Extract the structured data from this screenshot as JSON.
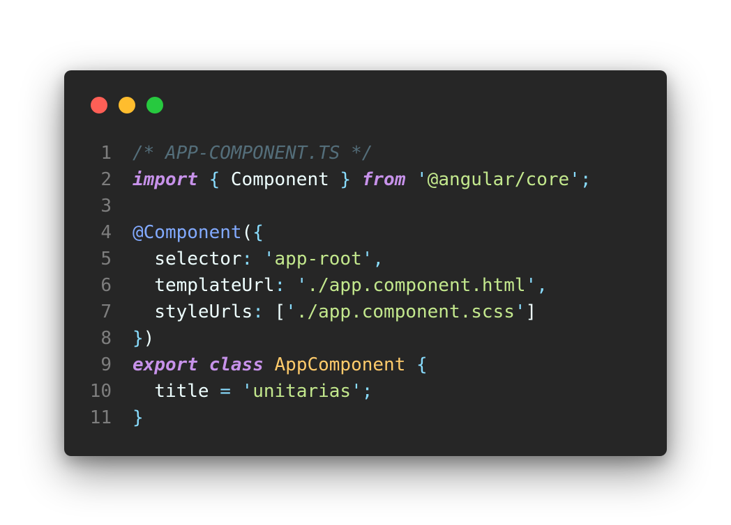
{
  "window": {
    "controls": {
      "close_color": "#ff5f56",
      "minimize_color": "#ffbd2e",
      "maximize_color": "#27c93f"
    }
  },
  "code": {
    "language": "typescript",
    "lines": [
      {
        "number": "1",
        "tokens": [
          {
            "type": "comment",
            "text": "/* APP-COMPONENT.TS */"
          }
        ]
      },
      {
        "number": "2",
        "tokens": [
          {
            "type": "keyword",
            "text": "import"
          },
          {
            "type": "plain",
            "text": " "
          },
          {
            "type": "punctuation",
            "text": "{"
          },
          {
            "type": "plain",
            "text": " Component "
          },
          {
            "type": "punctuation",
            "text": "}"
          },
          {
            "type": "plain",
            "text": " "
          },
          {
            "type": "keyword",
            "text": "from"
          },
          {
            "type": "plain",
            "text": " "
          },
          {
            "type": "punctuation",
            "text": "'"
          },
          {
            "type": "string",
            "text": "@angular/core"
          },
          {
            "type": "punctuation",
            "text": "'"
          },
          {
            "type": "punctuation",
            "text": ";"
          }
        ]
      },
      {
        "number": "3",
        "tokens": []
      },
      {
        "number": "4",
        "tokens": [
          {
            "type": "decorator",
            "text": "@Component"
          },
          {
            "type": "plain",
            "text": "("
          },
          {
            "type": "punctuation",
            "text": "{"
          }
        ]
      },
      {
        "number": "5",
        "tokens": [
          {
            "type": "plain",
            "text": "  selector"
          },
          {
            "type": "punctuation",
            "text": ":"
          },
          {
            "type": "plain",
            "text": " "
          },
          {
            "type": "punctuation",
            "text": "'"
          },
          {
            "type": "string",
            "text": "app-root"
          },
          {
            "type": "punctuation",
            "text": "'"
          },
          {
            "type": "punctuation",
            "text": ","
          }
        ]
      },
      {
        "number": "6",
        "tokens": [
          {
            "type": "plain",
            "text": "  templateUrl"
          },
          {
            "type": "punctuation",
            "text": ":"
          },
          {
            "type": "plain",
            "text": " "
          },
          {
            "type": "punctuation",
            "text": "'"
          },
          {
            "type": "string",
            "text": "./app.component.html"
          },
          {
            "type": "punctuation",
            "text": "'"
          },
          {
            "type": "punctuation",
            "text": ","
          }
        ]
      },
      {
        "number": "7",
        "tokens": [
          {
            "type": "plain",
            "text": "  styleUrls"
          },
          {
            "type": "punctuation",
            "text": ":"
          },
          {
            "type": "plain",
            "text": " ["
          },
          {
            "type": "punctuation",
            "text": "'"
          },
          {
            "type": "string",
            "text": "./app.component.scss"
          },
          {
            "type": "punctuation",
            "text": "'"
          },
          {
            "type": "plain",
            "text": "]"
          }
        ]
      },
      {
        "number": "8",
        "tokens": [
          {
            "type": "punctuation",
            "text": "}"
          },
          {
            "type": "plain",
            "text": ")"
          }
        ]
      },
      {
        "number": "9",
        "tokens": [
          {
            "type": "keyword",
            "text": "export"
          },
          {
            "type": "plain",
            "text": " "
          },
          {
            "type": "keyword",
            "text": "class"
          },
          {
            "type": "plain",
            "text": " "
          },
          {
            "type": "class",
            "text": "AppComponent"
          },
          {
            "type": "plain",
            "text": " "
          },
          {
            "type": "punctuation",
            "text": "{"
          }
        ]
      },
      {
        "number": "10",
        "tokens": [
          {
            "type": "plain",
            "text": "  title "
          },
          {
            "type": "punctuation",
            "text": "="
          },
          {
            "type": "plain",
            "text": " "
          },
          {
            "type": "punctuation",
            "text": "'"
          },
          {
            "type": "string",
            "text": "unitarias"
          },
          {
            "type": "punctuation",
            "text": "'"
          },
          {
            "type": "punctuation",
            "text": ";"
          }
        ]
      },
      {
        "number": "11",
        "tokens": [
          {
            "type": "punctuation",
            "text": "}"
          }
        ]
      }
    ]
  },
  "theme": {
    "background": "#262626",
    "keyword": "#c792ea",
    "punctuation": "#89ddff",
    "string": "#c3e88d",
    "comment": "#546e7a",
    "decorator": "#82aaff",
    "class": "#ffcb6b",
    "plain": "#eeffff",
    "line_number": "#7e7e7e"
  }
}
